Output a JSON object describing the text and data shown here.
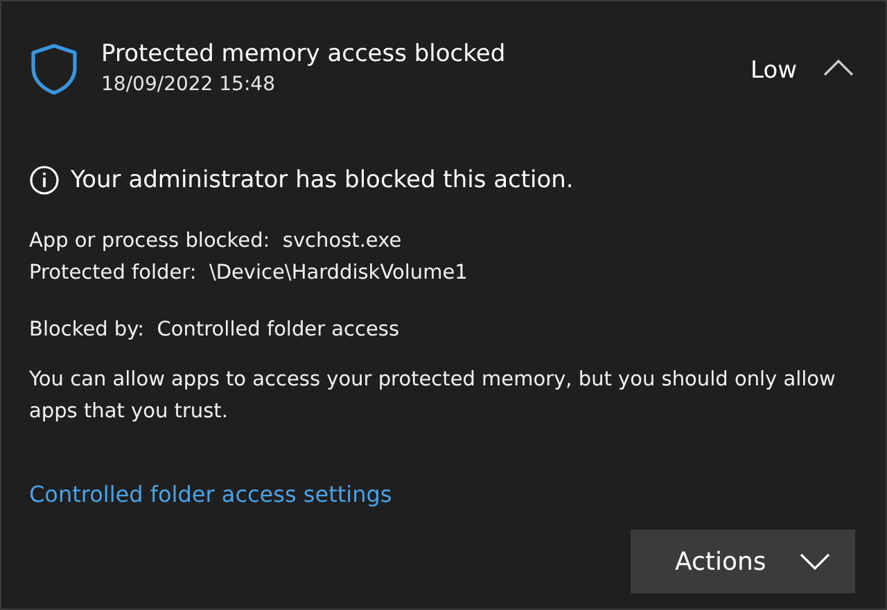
{
  "alert": {
    "title": "Protected memory access blocked",
    "timestamp": "18/09/2022 15:48",
    "severity": "Low",
    "expanded": true
  },
  "message": "Your administrator has blocked this action.",
  "details": [
    {
      "label": "App or process blocked:",
      "value": "svchost.exe"
    },
    {
      "label": "Protected folder:",
      "value": "\\Device\\HarddiskVolume1"
    }
  ],
  "blocked_by": {
    "label": "Blocked by:",
    "value": "Controlled folder access"
  },
  "description": "You can allow apps to access your protected memory, but you should only allow apps that you trust.",
  "link": "Controlled folder access settings",
  "actions_button": "Actions"
}
